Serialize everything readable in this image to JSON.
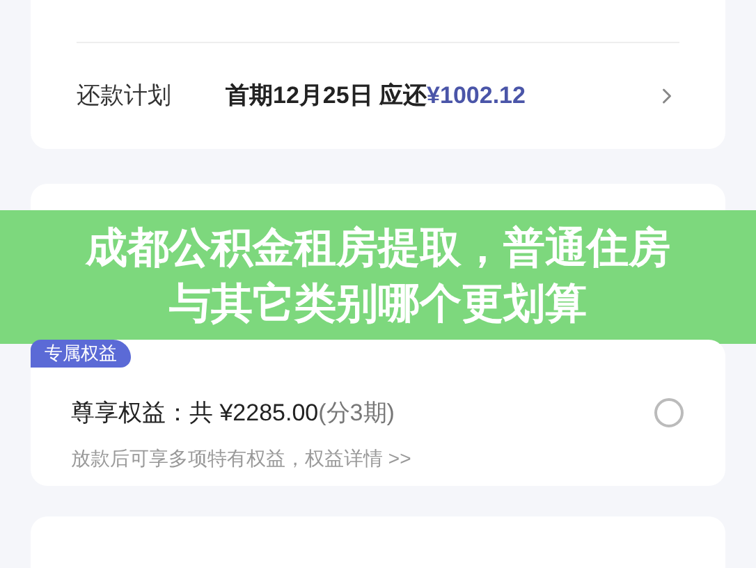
{
  "repayment_row": {
    "label": "还款计划",
    "value": "首期12月25日 应还",
    "amount": "¥1002.12"
  },
  "banner": {
    "title": "成都公积金租房提取，普通住房与其它类别哪个更划算"
  },
  "benefit_badge": "专属权益",
  "benefit": {
    "title": "尊享权益：共 ¥2285.00",
    "installments": "(分3期)",
    "description": "放款后可享多项特有权益，权益详情 >>",
    "selected": false
  }
}
